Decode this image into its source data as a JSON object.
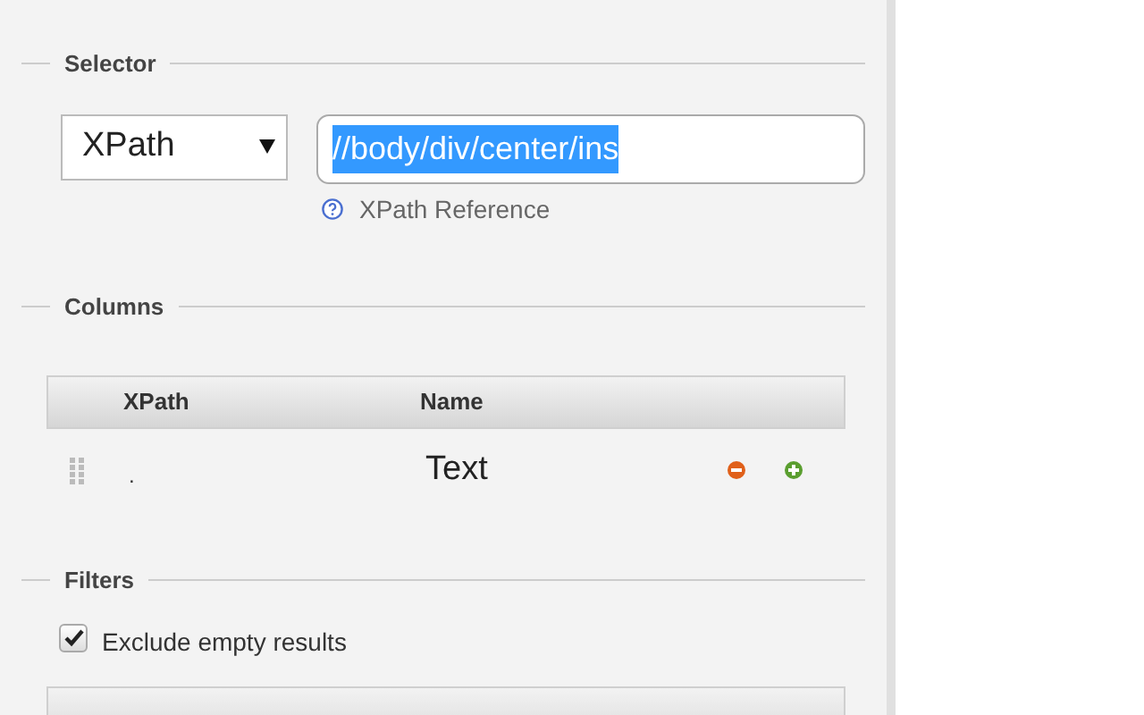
{
  "selector": {
    "legend": "Selector",
    "type": "XPath",
    "query": "//body/div/center/ins",
    "query_selected": true,
    "reference_link": "XPath Reference"
  },
  "columns": {
    "legend": "Columns",
    "headers": [
      "XPath",
      "Name"
    ],
    "rows": [
      {
        "xpath": ".",
        "name": "Text"
      }
    ]
  },
  "filters": {
    "legend": "Filters",
    "options": [
      {
        "label": "Exclude empty results",
        "checked": true
      }
    ]
  }
}
